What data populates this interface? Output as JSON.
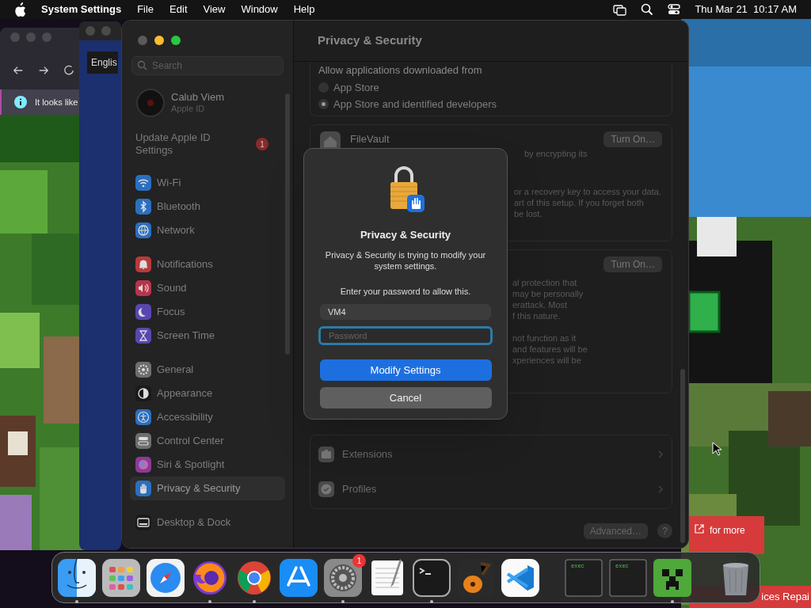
{
  "menu_bar": {
    "app_name": "System Settings",
    "menus": [
      "File",
      "Edit",
      "View",
      "Window",
      "Help"
    ],
    "clock": "Thu Mar 21  10:17 AM"
  },
  "browser_window": {
    "notice": "It looks like"
  },
  "back_window": {
    "language_button": "Englis"
  },
  "web_page": {
    "banner": "for more",
    "footer": "ices Repai"
  },
  "settings": {
    "search": {
      "placeholder": "Search"
    },
    "account": {
      "name": "Calub Viem",
      "subtitle": "Apple ID"
    },
    "update_notice": {
      "label": "Update Apple ID Settings",
      "badge": "1"
    },
    "sidebar_groups": [
      [
        {
          "kind": "wifi",
          "label": "Wi-Fi",
          "color": "#2a6fc0",
          "selected": false
        },
        {
          "kind": "bluetooth",
          "label": "Bluetooth",
          "color": "#2a6fc0",
          "selected": false
        },
        {
          "kind": "network",
          "label": "Network",
          "color": "#2a6fc0",
          "selected": false
        }
      ],
      [
        {
          "kind": "bell",
          "label": "Notifications",
          "color": "#b83a3a",
          "selected": false
        },
        {
          "kind": "sound",
          "label": "Sound",
          "color": "#b8344a",
          "selected": false
        },
        {
          "kind": "moon",
          "label": "Focus",
          "color": "#5a46b0",
          "selected": false
        },
        {
          "kind": "hourglass",
          "label": "Screen Time",
          "color": "#5a46b0",
          "selected": false
        }
      ],
      [
        {
          "kind": "gear",
          "label": "General",
          "color": "#6e6e6e",
          "selected": false
        },
        {
          "kind": "appearance",
          "label": "Appearance",
          "color": "#1a1a1a",
          "selected": false
        },
        {
          "kind": "accessibility",
          "label": "Accessibility",
          "color": "#2a6fc0",
          "selected": false
        },
        {
          "kind": "control",
          "label": "Control Center",
          "color": "#6e6e6e",
          "selected": false
        },
        {
          "kind": "siri",
          "label": "Siri & Spotlight",
          "color": "#8a3a9a",
          "selected": false
        },
        {
          "kind": "hand",
          "label": "Privacy & Security",
          "color": "#2a6fc0",
          "selected": true
        }
      ],
      [
        {
          "kind": "dock",
          "label": "Desktop & Dock",
          "color": "#1a1a1a",
          "selected": false
        }
      ]
    ],
    "title": "Privacy & Security",
    "downloads": {
      "heading": "Allow applications downloaded from",
      "options": [
        {
          "label": "App Store",
          "selected": false
        },
        {
          "label": "App Store and identified developers",
          "selected": true
        }
      ]
    },
    "filevault": {
      "title": "FileVault",
      "button": "Turn On…",
      "description": "by encrypting its",
      "fragments": [
        "or a recovery key to access your data.",
        "art of this setup. If you forget both",
        "be lost."
      ]
    },
    "lockdown": {
      "button": "Turn On…",
      "fragments": [
        [
          "al protection that",
          "may be personally",
          "erattack. Most",
          "f this nature."
        ],
        [
          "not function as it",
          "and features will be",
          "xperiences will be"
        ]
      ]
    },
    "rows": [
      {
        "kind": "extensions",
        "label": "Extensions"
      },
      {
        "kind": "profiles",
        "label": "Profiles"
      }
    ],
    "advanced_button": "Advanced…",
    "help_button": "?"
  },
  "dialog": {
    "title": "Privacy & Security",
    "message": "Privacy & Security is trying to modify your system settings.",
    "prompt": "Enter your password to allow this.",
    "username": "VM4",
    "password": {
      "placeholder": "Password",
      "focused": true
    },
    "buttons": [
      {
        "label": "Modify Settings",
        "kind": "primary"
      },
      {
        "label": "Cancel",
        "kind": "secondary"
      }
    ]
  },
  "dock": [
    {
      "kind": "finder",
      "running": true
    },
    {
      "kind": "launchpad",
      "running": false
    },
    {
      "kind": "safari",
      "running": false
    },
    {
      "kind": "firefox",
      "running": true
    },
    {
      "kind": "chrome",
      "running": true
    },
    {
      "kind": "appstore",
      "running": false
    },
    {
      "kind": "settings",
      "running": true,
      "badge": "1"
    },
    {
      "kind": "textedit",
      "running": false
    },
    {
      "kind": "terminal",
      "running": true
    },
    {
      "kind": "garageband",
      "running": false
    },
    {
      "kind": "vscode",
      "running": false
    },
    {
      "kind": "separator"
    },
    {
      "kind": "exec",
      "text": "exec",
      "running": false
    },
    {
      "kind": "exec",
      "text": "exec",
      "running": false
    },
    {
      "kind": "minecraft",
      "running": true
    },
    {
      "kind": "separator"
    },
    {
      "kind": "trash",
      "running": false
    }
  ]
}
